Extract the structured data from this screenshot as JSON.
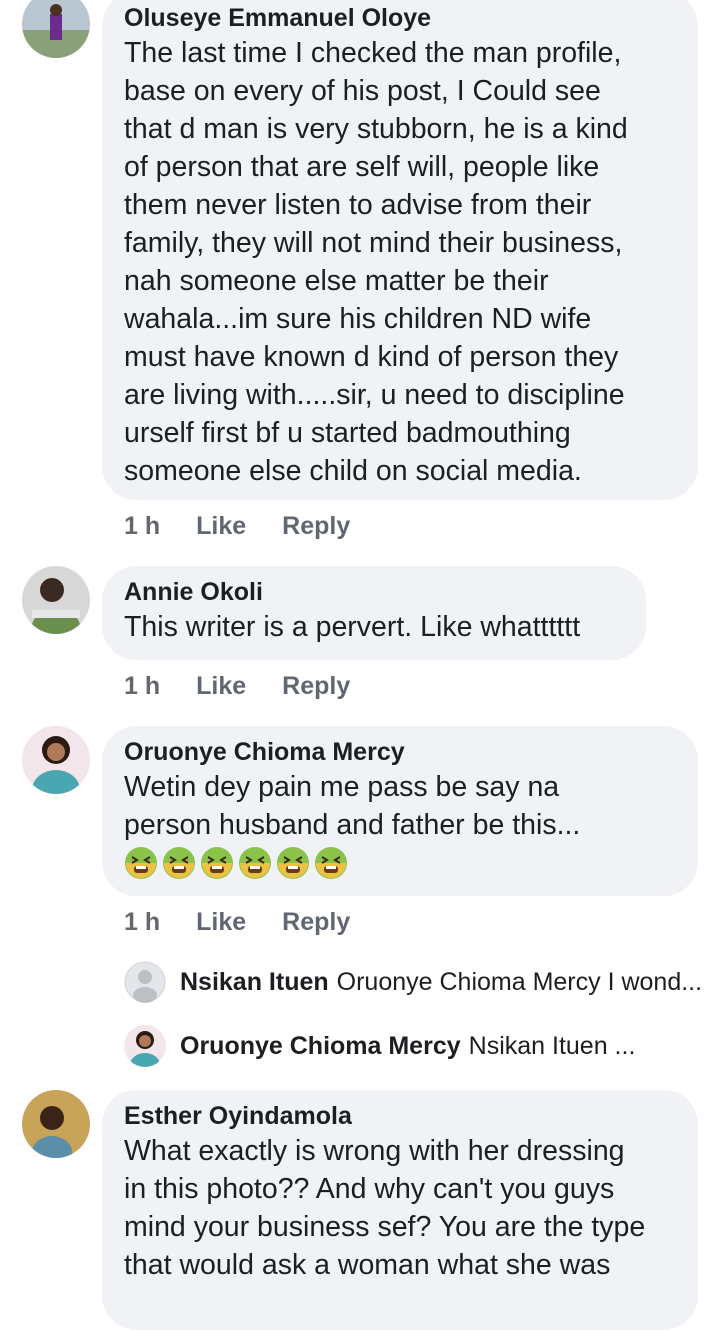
{
  "comments": [
    {
      "author": "Oluseye Emmanuel Oloye",
      "text": "The last time I checked the man profile,\nbase on every of his post,  I Could see\nthat d man is very stubborn, he is a kind\nof person that are self will, people like\nthem never listen to advise from their\nfamily, they will not mind their business,\nnah someone else  matter be their\nwahala...im sure his children ND wife\nmust have known d kind of person they\nare living  with.....sir,  u need to discipline\nurself first bf u started badmouthing\nsomeone else child on social media.",
      "time": "1 h",
      "like": "Like",
      "reply": "Reply"
    },
    {
      "author": "Annie Okoli",
      "text": "This writer is a pervert. Like whatttttt",
      "time": "1 h",
      "like": "Like",
      "reply": "Reply"
    },
    {
      "author": "Oruonye Chioma Mercy",
      "text": "Wetin dey pain me pass be say na\nperson husband and father be this...",
      "emoji_icon": "nauseated-face-emoji",
      "emoji_count": 6,
      "time": "1 h",
      "like": "Like",
      "reply": "Reply",
      "replies": [
        {
          "author": "Nsikan Ituen",
          "text": "Oruonye Chioma Mercy I wond..."
        },
        {
          "author": "Oruonye Chioma Mercy",
          "text": "Nsikan Ituen ..."
        }
      ]
    },
    {
      "author": "Esther Oyindamola",
      "text": "What exactly is wrong with her dressing\nin this photo?? And why can't you guys\nmind your business sef? You are the type\nthat would ask a woman what she was"
    }
  ]
}
